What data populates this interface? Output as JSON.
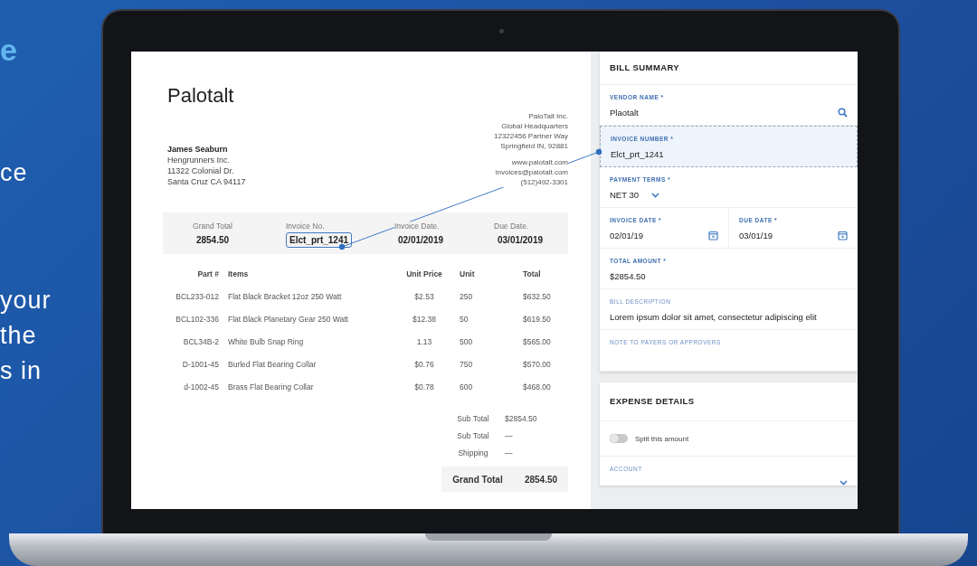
{
  "promo_text": [
    {
      "kind": "heading",
      "lines": [
        "e"
      ]
    },
    {
      "kind": "body",
      "lines": [
        "ce"
      ]
    },
    {
      "kind": "body",
      "lines": [
        "your",
        "the",
        "s in"
      ]
    }
  ],
  "invoice": {
    "company_title": "Palotalt",
    "bill_to": {
      "name": "James Seaburn",
      "lines": [
        "Hengrunners Inc.",
        "11322 Colonial Dr.",
        "Santa Cruz CA 94117"
      ]
    },
    "vendor_address": [
      "PaloTalt Inc.",
      "Global Headquarters",
      "12322456 Partner Way",
      "Springfield IN, 92881"
    ],
    "vendor_contact": [
      "www.palotalt.com",
      "invoices@palotalt.com",
      "(512)492-3301"
    ],
    "summary": [
      {
        "label": "Grand Total",
        "value": "2854.50",
        "highlighted": false
      },
      {
        "label": "Invoice No.",
        "value": "Elct_prt_1241",
        "highlighted": true
      },
      {
        "label": "Invoice Date.",
        "value": "02/01/2019",
        "highlighted": false
      },
      {
        "label": "Due Date.",
        "value": "03/01/2019",
        "highlighted": false
      }
    ],
    "table": {
      "columns": [
        "Part #",
        "Items",
        "Unit Price",
        "Unit",
        "Total"
      ],
      "rows": [
        [
          "BCL233-012",
          "Flat Black Bracket 12oz 250 Watt",
          "$2.53",
          "250",
          "$632.50"
        ],
        [
          "BCL102-336",
          "Flat Black Planetary Gear 250 Watt",
          "$12.38",
          "50",
          "$619.50"
        ],
        [
          "BCL34B-2",
          "White Bulb Snap Ring",
          "1.13",
          "500",
          "$565.00"
        ],
        [
          "D-1001-45",
          "Burled Flat Bearing Collar",
          "$0.76",
          "750",
          "$570.00"
        ],
        [
          "d-1002-45",
          "Brass Flat Bearing Collar",
          "$0.78",
          "600",
          "$468.00"
        ]
      ]
    },
    "totals": [
      {
        "label": "Sub Total",
        "value": "$2854.50"
      },
      {
        "label": "Sub Total",
        "value": "—"
      },
      {
        "label": "Shipping",
        "value": "—"
      }
    ],
    "grand_total": {
      "label": "Grand Total",
      "value": "2854.50"
    }
  },
  "bill_summary": {
    "title": "BILL SUMMARY",
    "fields": [
      {
        "kind": "search",
        "label": "VENDOR NAME *",
        "value": "Plaotalt",
        "highlighted": false
      },
      {
        "kind": "text",
        "label": "INVOICE NUMBER *",
        "value": "Elct_prt_1241",
        "highlighted": true
      },
      {
        "kind": "select",
        "label": "PAYMENT TERMS *",
        "value": "NET 30",
        "highlighted": false
      },
      {
        "kind": "dates",
        "highlighted": false,
        "dates": [
          {
            "label": "INVOICE DATE *",
            "value": "02/01/19"
          },
          {
            "label": "DUE DATE *",
            "value": "03/01/19"
          }
        ]
      },
      {
        "kind": "text",
        "label": "TOTAL AMOUNT *",
        "value": "$2854.50",
        "highlighted": false
      },
      {
        "kind": "text",
        "label": "BILL DESCRIPTION",
        "value": "Lorem ipsum dolor sit amet, consectetur adipiscing elit",
        "highlighted": false
      },
      {
        "kind": "note",
        "label": "NOTE TO PAYERS OR APPROVERS",
        "highlighted": false
      }
    ]
  },
  "expense_details": {
    "title": "EXPENSE DETAILS",
    "split_toggle": {
      "label": "Split this amount",
      "on": false
    },
    "account": {
      "label": "ACCOUNT"
    }
  }
}
